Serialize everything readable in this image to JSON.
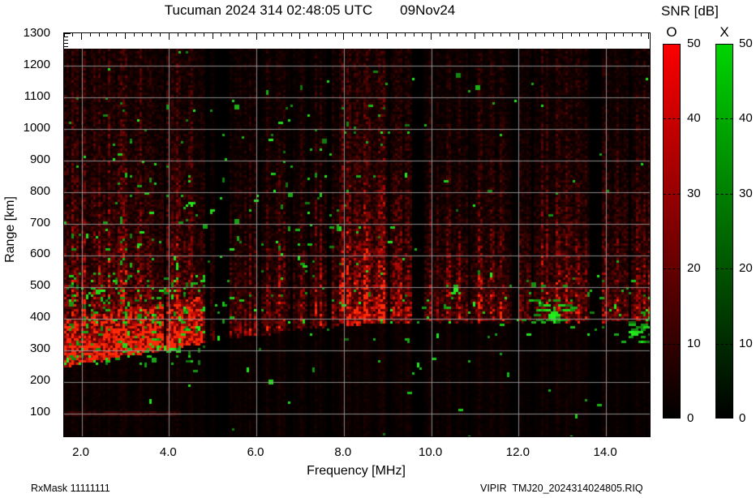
{
  "header": {
    "title": "Tucuman 2024 314 02:48:05 UTC",
    "date": "09Nov24"
  },
  "footer": {
    "rx_mask": "RxMask 11111111",
    "filename": "VIPIR  TMJ20_2024314024805.RIQ"
  },
  "axes": {
    "x_label": "Frequency [MHz]",
    "y_label": "Range [km]",
    "x_ticks": [
      {
        "value": 2,
        "label": "2.0"
      },
      {
        "value": 4,
        "label": "4.0"
      },
      {
        "value": 6,
        "label": "6.0"
      },
      {
        "value": 8,
        "label": "8.0"
      },
      {
        "value": 10,
        "label": "10.0"
      },
      {
        "value": 12,
        "label": "12.0"
      },
      {
        "value": 14,
        "label": "14.0"
      }
    ],
    "y_ticks": [
      {
        "value": 1300,
        "label": "1300"
      },
      {
        "value": 1200,
        "label": "1200"
      },
      {
        "value": 1100,
        "label": "1100"
      },
      {
        "value": 1000,
        "label": "1000"
      },
      {
        "value": 900,
        "label": "900"
      },
      {
        "value": 800,
        "label": "800"
      },
      {
        "value": 700,
        "label": "700"
      },
      {
        "value": 600,
        "label": "600"
      },
      {
        "value": 500,
        "label": "500"
      },
      {
        "value": 400,
        "label": "400"
      },
      {
        "value": 300,
        "label": "300"
      },
      {
        "value": 200,
        "label": "200"
      },
      {
        "value": 100,
        "label": "100"
      }
    ],
    "x_minor_step": 0.2,
    "y_minor_ticks": [
      1300,
      1290,
      1280,
      1270,
      1260
    ]
  },
  "colorbar": {
    "title": "SNR [dB]",
    "min": 0,
    "max": 50,
    "tick_labels": [
      {
        "value": 50,
        "label": "50"
      },
      {
        "value": 40,
        "label": "40"
      },
      {
        "value": 30,
        "label": "30"
      },
      {
        "value": 20,
        "label": "20"
      },
      {
        "value": 10,
        "label": "10"
      },
      {
        "value": 0,
        "label": "0"
      }
    ],
    "dash_values": [
      40,
      30,
      20,
      10
    ],
    "bars": [
      {
        "name": "O",
        "top_color": "#fb0000"
      },
      {
        "name": "X",
        "top_color": "#00d400"
      }
    ]
  },
  "chart_data": {
    "type": "heatmap",
    "title": "Tucuman 2024 314 02:48:05 UTC 09Nov24",
    "xlabel": "Frequency [MHz]",
    "ylabel": "Range [km]",
    "legend": "SNR [dB], O-mode (red) and X-mode (green), 0-50 dB",
    "x_range": [
      1.6,
      15.0
    ],
    "y_range_km": [
      20,
      1300
    ],
    "range_at_canvas_top": 1254,
    "range_at_canvas_bottom": 28,
    "snr_range_db": [
      0,
      50
    ],
    "grid": {
      "x_step_mhz": 2,
      "y_step_km": 100,
      "color": "#999999",
      "on": true
    },
    "seed": 20243144,
    "noise_edge_km": [
      [
        1.6,
        250
      ],
      [
        1.75,
        258
      ],
      [
        2.2,
        268
      ],
      [
        3.0,
        284
      ],
      [
        4.0,
        306
      ],
      [
        4.8,
        326
      ],
      [
        5.6,
        344
      ],
      [
        6.4,
        360
      ],
      [
        7.2,
        374
      ],
      [
        8.0,
        384
      ],
      [
        9.0,
        390
      ],
      [
        10.0,
        392
      ],
      [
        15.0,
        396
      ]
    ],
    "band_profile": [
      [
        1.6,
        0.95
      ],
      [
        4.6,
        0.92
      ],
      [
        4.9,
        0.5
      ],
      [
        5.35,
        0.45
      ],
      [
        5.9,
        0.52
      ],
      [
        6.5,
        0.56
      ],
      [
        7.05,
        0.5
      ],
      [
        7.6,
        0.68
      ],
      [
        8.1,
        0.82
      ],
      [
        8.8,
        0.85
      ],
      [
        9.3,
        0.68
      ],
      [
        9.9,
        0.45
      ],
      [
        10.5,
        0.56
      ],
      [
        11.2,
        0.55
      ],
      [
        11.9,
        0.5
      ],
      [
        12.5,
        0.62
      ],
      [
        13.1,
        0.6
      ],
      [
        13.8,
        0.55
      ],
      [
        14.3,
        0.6
      ],
      [
        15.0,
        0.65
      ]
    ],
    "hot_zone": {
      "f_max": 4.78,
      "depth_km": 150
    },
    "decay_km": 235,
    "floor": 0.11,
    "dark_stripes": [
      [
        4.82,
        4.94
      ],
      [
        5.06,
        5.36
      ],
      [
        6.78,
        6.85
      ],
      [
        7.63,
        7.7
      ],
      [
        9.54,
        9.84
      ],
      [
        11.86,
        12.02
      ],
      [
        13.64,
        13.9
      ],
      [
        10.84,
        10.91
      ],
      [
        9.0,
        9.06
      ],
      [
        14.52,
        14.58
      ],
      [
        12.28,
        12.34
      ],
      [
        6.06,
        6.1
      ],
      [
        7.16,
        7.2
      ],
      [
        3.88,
        3.92
      ]
    ],
    "bright_bands": [
      [
        7.9,
        9.3,
        0.2
      ],
      [
        10.45,
        11.65,
        0.1
      ],
      [
        12.05,
        13.45,
        0.12
      ],
      [
        13.95,
        15.0,
        0.15
      ],
      [
        4.05,
        4.6,
        0.15
      ],
      [
        2.4,
        3.2,
        0.1
      ]
    ],
    "faint_rows": [
      {
        "f_max": 4.3,
        "r0": 96,
        "r1": 116,
        "add": 0.1
      }
    ],
    "green_regions": [
      {
        "f": [
          1.6,
          4.85
        ],
        "r": [
          260,
          545
        ],
        "p": 0.1,
        "dash": false
      },
      {
        "f": [
          1.6,
          3.4
        ],
        "r": [
          545,
          710
        ],
        "p": 0.05,
        "dash": false
      },
      {
        "f": [
          1.6,
          4.85
        ],
        "r": [
          545,
          1110
        ],
        "p": 0.013,
        "dash": false
      },
      {
        "f": [
          4.85,
          9.5
        ],
        "r": [
          330,
          1090
        ],
        "p": 0.016,
        "dash": false
      },
      {
        "f": [
          6.3,
          9.4
        ],
        "r": [
          860,
          1075
        ],
        "p": 0.022,
        "dash": false
      },
      {
        "f": [
          9.5,
          15.0
        ],
        "r": [
          340,
          560
        ],
        "p": 0.018,
        "dash": false
      },
      {
        "f": [
          12.05,
          13.3
        ],
        "r": [
          385,
          465
        ],
        "p": 0.17,
        "dash": true
      },
      {
        "f": [
          14.5,
          15.0
        ],
        "r": [
          330,
          435
        ],
        "p": 0.17,
        "dash": true
      },
      {
        "f": [
          10.28,
          10.65
        ],
        "r": [
          425,
          535
        ],
        "p": 0.09,
        "dash": false
      },
      {
        "f": [
          6.25,
          6.6
        ],
        "r": [
          555,
          665
        ],
        "p": 0.08,
        "dash": false
      },
      {
        "f": [
          1.6,
          15.0
        ],
        "r": [
          28,
          1254
        ],
        "p": 0.0035,
        "dash": false
      }
    ]
  }
}
